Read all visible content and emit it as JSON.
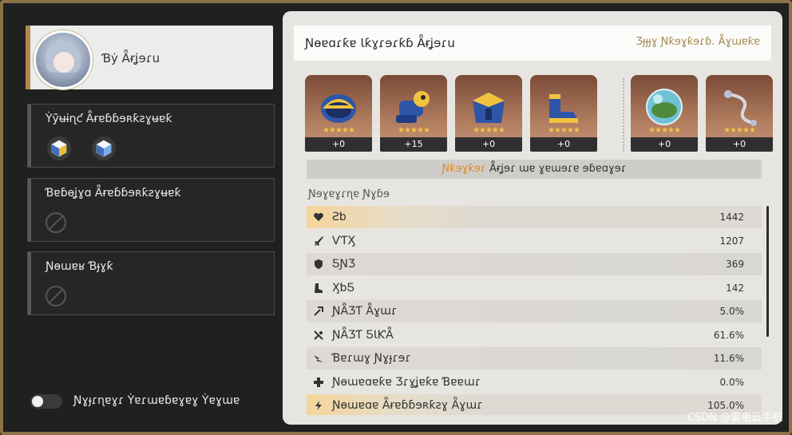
{
  "profile": {
    "name": "Ɓẏ Ǟɍʝɘɾu"
  },
  "slots": [
    {
      "title": "Ỳỹʉɨɳƈ Ǟɍɐɓɓɘʀƙƨɣʉɐƙ"
    },
    {
      "title": "Ɓɐɓɵʝɣɑ Ǟɍɐɓɓɘʀƙƨɣʉɐƙ"
    },
    {
      "title": "Ɲɵɯɐʁ Ɓɟɣƙ"
    }
  ],
  "toggle": {
    "label": "Ɲɣɟɾɳɐɣɾ Ỳɐɾɯɐɓɐɣɐɣ Ỳɐɣɯɐ"
  },
  "header": {
    "title": "Ɲɵɐɑɾƙɐ Ɩƙɣɾɘɾƙɓ Ǟɍʝɘɾu",
    "right": "Ʒɟɟɟɣ Ɲƙɘɣƙɘɾɓ. Ǟɣɯɐƙɐ"
  },
  "items": [
    {
      "level": "+0"
    },
    {
      "level": "+15"
    },
    {
      "level": "+0"
    },
    {
      "level": "+0"
    },
    {
      "level": "+0"
    },
    {
      "level": "+0"
    }
  ],
  "stars": "★★★★★",
  "notice": {
    "highlight": "Ɲƙɘɣƙɘɾ",
    "text": " Ǟɍʝɘɾ ɯɐ ɣɐɯɘɾɐ ɘɓɐɑɣɘɾ"
  },
  "stats_title": "Ɲɘɣɐɣɾɳɐ Ɲɣɓɘ",
  "stats": [
    {
      "name": "Ƨƅ",
      "value": "1442"
    },
    {
      "name": "ѴƬӼ",
      "value": "1207"
    },
    {
      "name": "ƼƝƷ",
      "value": "369"
    },
    {
      "name": "ӼƅƼ",
      "value": "142"
    },
    {
      "name": "ƝǞƷƬ Ǟɣɯɾ",
      "value": "5.0%"
    },
    {
      "name": "ƝǞƷƬ ƼƖƘǞ",
      "value": "61.6%"
    },
    {
      "name": "Ɓɐɾɯɣ Ɲɣɟɾɘɾ",
      "value": "11.6%"
    },
    {
      "name": "Ɲɵɯɐɑɐƙɐ Ʒɾɣʝɐƙɐ Ɓɐɐɯɾ",
      "value": "0.0%"
    },
    {
      "name": "Ɲɵɯɐɑɐ Ǟɍɐɓɓɘʀƙƨɣ Ǟɣɯɾ",
      "value": "105.0%"
    }
  ],
  "watermark": "CSDN @雷电云手机",
  "colors": {
    "gold": "#b08a4a",
    "accent": "#e08a1c",
    "panel": "#e7e5e1"
  }
}
